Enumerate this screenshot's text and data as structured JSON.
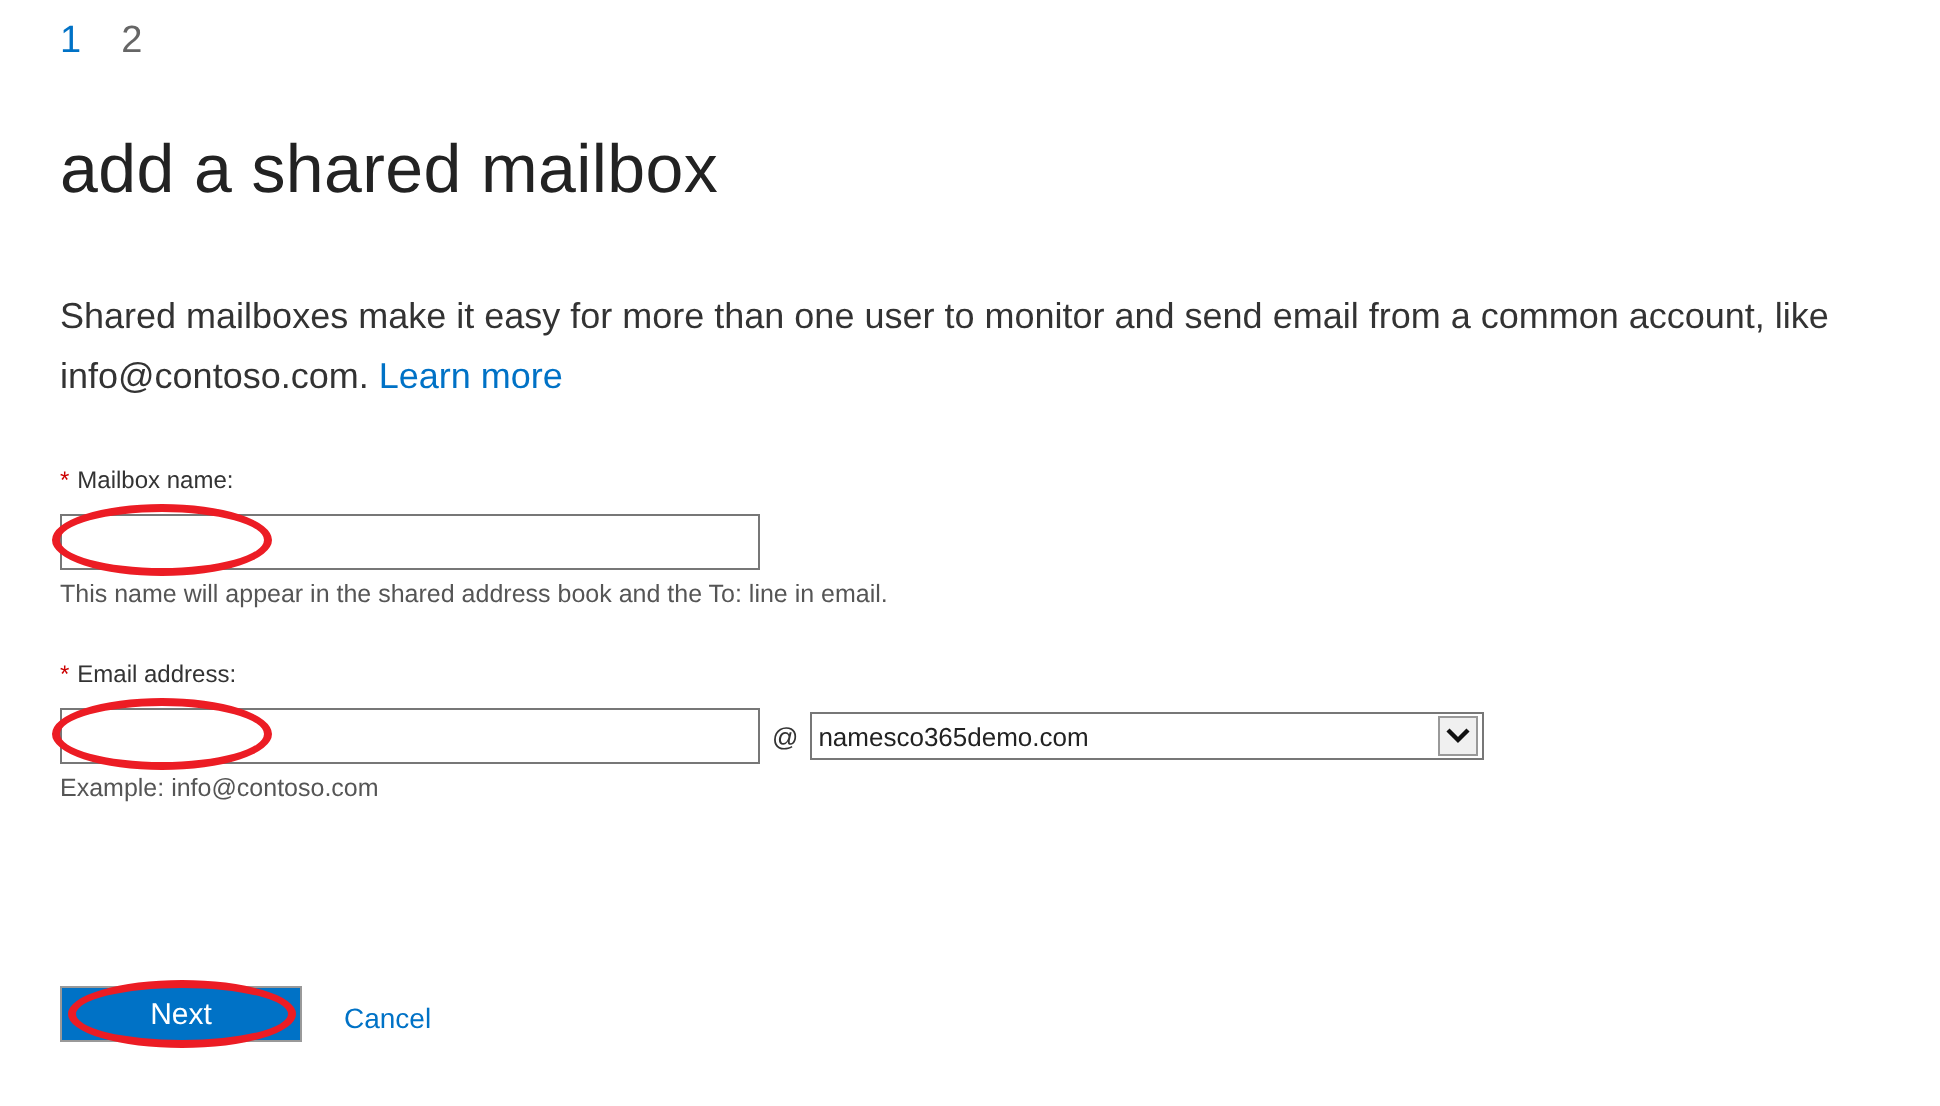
{
  "steps": [
    {
      "label": "1",
      "selected": true
    },
    {
      "label": "2",
      "selected": false
    }
  ],
  "title": "add a shared mailbox",
  "description": {
    "text": "Shared mailboxes make it easy for more than one user to monitor and send email from a common account, like info@contoso.com.",
    "link": "Learn more"
  },
  "fields": [
    {
      "kind": "text",
      "required_mark": "*",
      "label": "Mailbox name:",
      "hint": "This name will appear in the shared address book and the To: line in email.",
      "circled": true
    },
    {
      "kind": "email",
      "required_mark": "*",
      "label": "Email address:",
      "at_sign": "@",
      "domain": "namesco365demo.com",
      "hint": "Example: info@contoso.com",
      "circled": true
    }
  ],
  "buttons": [
    {
      "kind": "primary",
      "label": "Next",
      "circled": true
    },
    {
      "kind": "link",
      "label": "Cancel",
      "circled": false
    }
  ]
}
